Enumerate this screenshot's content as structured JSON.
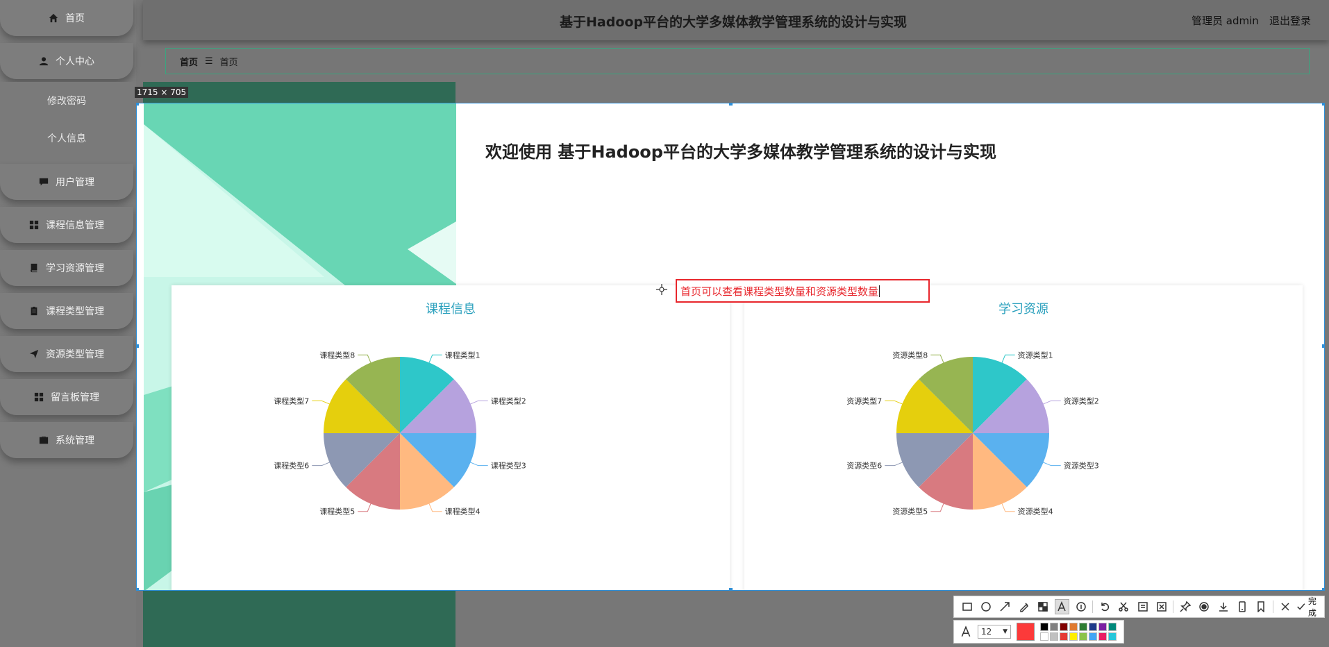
{
  "header": {
    "title": "基于Hadoop平台的大学多媒体教学管理系统的设计与实现",
    "user_role": "管理员 admin",
    "logout": "退出登录"
  },
  "breadcrumb": {
    "home": "首页",
    "separator": "☰",
    "current": "首页"
  },
  "sidebar": {
    "items": [
      {
        "label": "首页",
        "icon": "home-icon"
      },
      {
        "label": "个人中心",
        "icon": "user-icon"
      },
      {
        "label": "修改密码",
        "icon": ""
      },
      {
        "label": "个人信息",
        "icon": ""
      },
      {
        "label": "用户管理",
        "icon": "chat-icon"
      },
      {
        "label": "课程信息管理",
        "icon": "grid-icon"
      },
      {
        "label": "学习资源管理",
        "icon": "book-icon"
      },
      {
        "label": "课程类型管理",
        "icon": "clipboard-icon"
      },
      {
        "label": "资源类型管理",
        "icon": "send-icon"
      },
      {
        "label": "留言板管理",
        "icon": "grid-icon"
      },
      {
        "label": "系统管理",
        "icon": "briefcase-icon"
      }
    ]
  },
  "capture": {
    "size_label": "1715 × 705"
  },
  "welcome": "欢迎使用 基于Hadoop平台的大学多媒体教学管理系统的设计与实现",
  "annotation": {
    "text": "首页可以查看课程类型数量和资源类型数量"
  },
  "toolbar": {
    "finish_label": "完成",
    "font_size": "12",
    "current_color": "#fc3a3a",
    "palette": [
      "#000000",
      "#808080",
      "#800000",
      "#e07a30",
      "#2e7d32",
      "#1e3a8a",
      "#7b1fa2",
      "#00897b",
      "#ffffff",
      "#c0c0c0",
      "#e53935",
      "#ffee00",
      "#8bc34a",
      "#42a5f5",
      "#e91e63",
      "#26c6da"
    ]
  },
  "colors": {
    "slices": [
      "#2ec7c9",
      "#b6a2de",
      "#5ab1ef",
      "#ffb980",
      "#d87a80",
      "#8d98b3",
      "#e5cf0d",
      "#97b552"
    ]
  },
  "chart_data": [
    {
      "type": "pie",
      "title": "课程信息",
      "categories": [
        "课程类型1",
        "课程类型2",
        "课程类型3",
        "课程类型4",
        "课程类型5",
        "课程类型6",
        "课程类型7",
        "课程类型8"
      ],
      "values": [
        1,
        1,
        1,
        1,
        1,
        1,
        1,
        1
      ]
    },
    {
      "type": "pie",
      "title": "学习资源",
      "categories": [
        "资源类型1",
        "资源类型2",
        "资源类型3",
        "资源类型4",
        "资源类型5",
        "资源类型6",
        "资源类型7",
        "资源类型8"
      ],
      "values": [
        1,
        1,
        1,
        1,
        1,
        1,
        1,
        1
      ]
    }
  ]
}
